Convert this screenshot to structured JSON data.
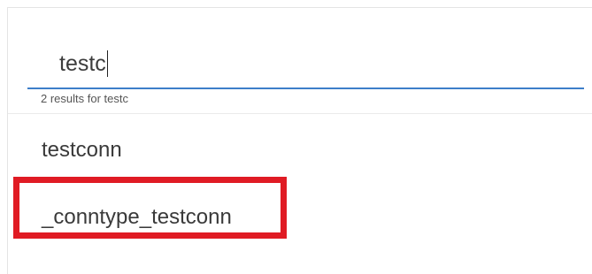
{
  "search": {
    "value": "testc",
    "results_label": "2 results for testc"
  },
  "results": [
    {
      "label": "testconn"
    },
    {
      "label": "_conntype_testconn"
    }
  ],
  "colors": {
    "underline": "#3d7ec9",
    "highlight": "#e01b24"
  }
}
